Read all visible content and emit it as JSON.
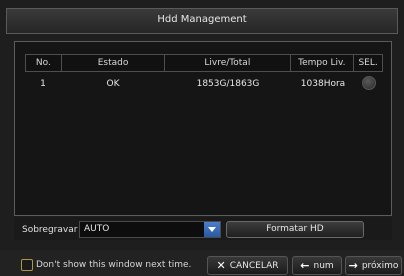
{
  "window": {
    "title": "Hdd Management"
  },
  "table": {
    "headers": [
      "No.",
      "Estado",
      "Livre/Total",
      "Tempo Liv.",
      "SEL."
    ],
    "rows": [
      {
        "no": "1",
        "estado": "OK",
        "livre_total": "1853G/1863G",
        "tempo": "1038Hora"
      }
    ]
  },
  "overwrite": {
    "label": "Sobregravar",
    "value": "AUTO"
  },
  "format_button": {
    "label": "Formatar HD"
  },
  "footer": {
    "dont_show_label": "Don't show this window next time.",
    "cancel_label": "CANCELAR",
    "prev_label": "num",
    "next_label": "próximo"
  },
  "icons": {
    "cancel": "close-icon",
    "prev": "arrow-left-icon",
    "next": "arrow-right-icon",
    "dropdown": "chevron-down-icon"
  },
  "colors": {
    "accent": "#2a58a3",
    "checkbox_border": "#a89a48"
  }
}
